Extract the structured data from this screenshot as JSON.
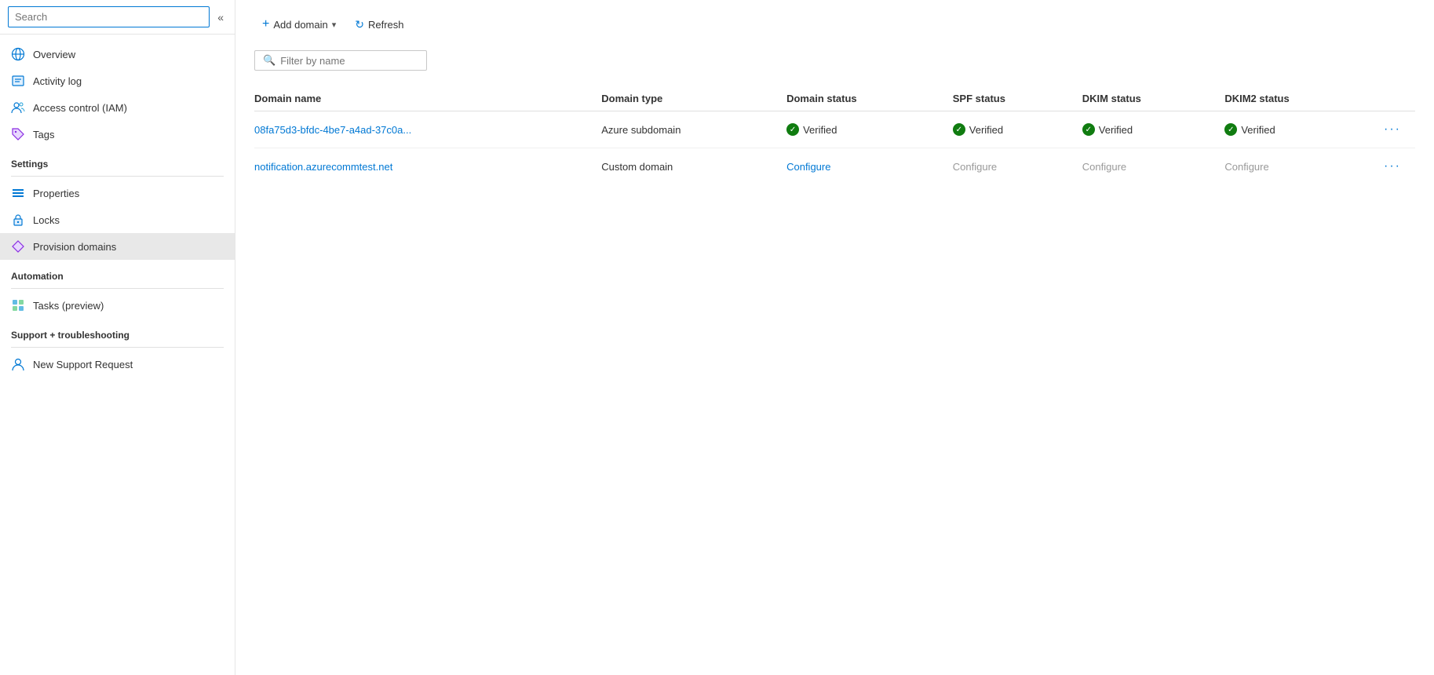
{
  "sidebar": {
    "search_placeholder": "Search",
    "collapse_icon": "«",
    "nav_items": [
      {
        "id": "overview",
        "label": "Overview",
        "icon": "globe"
      },
      {
        "id": "activity-log",
        "label": "Activity log",
        "icon": "activity"
      },
      {
        "id": "access-control",
        "label": "Access control (IAM)",
        "icon": "people"
      },
      {
        "id": "tags",
        "label": "Tags",
        "icon": "tag"
      }
    ],
    "settings_section": "Settings",
    "settings_items": [
      {
        "id": "properties",
        "label": "Properties",
        "icon": "bars"
      },
      {
        "id": "locks",
        "label": "Locks",
        "icon": "lock"
      },
      {
        "id": "provision-domains",
        "label": "Provision domains",
        "icon": "diamond",
        "active": true
      }
    ],
    "automation_section": "Automation",
    "automation_items": [
      {
        "id": "tasks-preview",
        "label": "Tasks (preview)",
        "icon": "tasks"
      }
    ],
    "support_section": "Support + troubleshooting",
    "support_items": [
      {
        "id": "new-support-request",
        "label": "New Support Request",
        "icon": "person"
      }
    ]
  },
  "toolbar": {
    "add_domain_label": "Add domain",
    "add_domain_chevron": "▾",
    "refresh_label": "Refresh"
  },
  "filter": {
    "placeholder": "Filter by name"
  },
  "table": {
    "columns": [
      {
        "id": "domain-name",
        "label": "Domain name"
      },
      {
        "id": "domain-type",
        "label": "Domain type"
      },
      {
        "id": "domain-status",
        "label": "Domain status"
      },
      {
        "id": "spf-status",
        "label": "SPF status"
      },
      {
        "id": "dkim-status",
        "label": "DKIM status"
      },
      {
        "id": "dkim2-status",
        "label": "DKIM2 status"
      }
    ],
    "rows": [
      {
        "domain_name": "08fa75d3-bfdc-4be7-a4ad-37c0a...",
        "domain_type": "Azure subdomain",
        "domain_status": "Verified",
        "domain_status_type": "verified",
        "spf_status": "Verified",
        "spf_status_type": "verified",
        "dkim_status": "Verified",
        "dkim_status_type": "verified",
        "dkim2_status": "Verified",
        "dkim2_status_type": "verified"
      },
      {
        "domain_name": "notification.azurecommtest.net",
        "domain_type": "Custom domain",
        "domain_status": "Configure",
        "domain_status_type": "configure-link",
        "spf_status": "Configure",
        "spf_status_type": "configure-text",
        "dkim_status": "Configure",
        "dkim_status_type": "configure-text",
        "dkim2_status": "Configure",
        "dkim2_status_type": "configure-text"
      }
    ]
  },
  "colors": {
    "accent": "#0078d4",
    "verified_green": "#107c10",
    "border": "#e0e0e0"
  }
}
